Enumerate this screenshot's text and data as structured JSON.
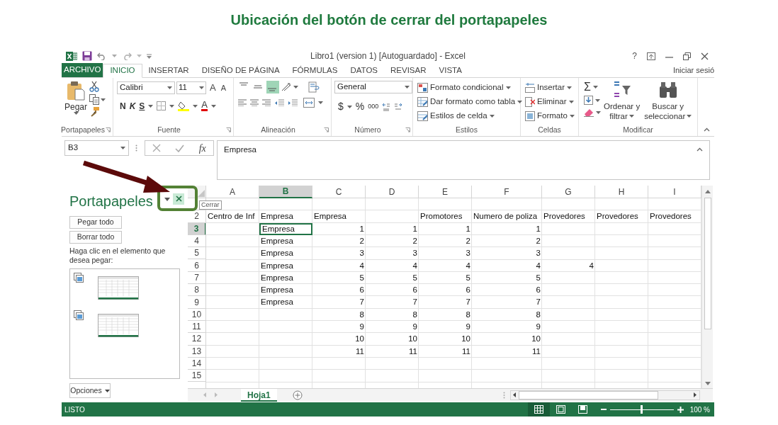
{
  "annotation_title": "Ubicación del botón de cerrar del portapapeles",
  "window": {
    "title": "Libro1 (version 1) [Autoguardado] - Excel",
    "help": "?"
  },
  "tabs": [
    {
      "label": "ARCHIVO",
      "kind": "file",
      "selected": false
    },
    {
      "label": "INICIO",
      "kind": "tab",
      "selected": true
    },
    {
      "label": "INSERTAR",
      "kind": "tab",
      "selected": false
    },
    {
      "label": "DISEÑO DE PÁGINA",
      "kind": "tab",
      "selected": false
    },
    {
      "label": "FÓRMULAS",
      "kind": "tab",
      "selected": false
    },
    {
      "label": "DATOS",
      "kind": "tab",
      "selected": false
    },
    {
      "label": "REVISAR",
      "kind": "tab",
      "selected": false
    },
    {
      "label": "VISTA",
      "kind": "tab",
      "selected": false
    }
  ],
  "account": "Iniciar sesió",
  "ribbon": {
    "groups": [
      {
        "kind": "clipboard",
        "label": "Portapapeles",
        "launcher": true,
        "paste": "Pegar"
      },
      {
        "kind": "font",
        "label": "Fuente",
        "launcher": true,
        "font": "Calibri",
        "size": "11",
        "grow": "A",
        "shrink": "A",
        "bold": "N",
        "italic": "K",
        "underline": "S",
        "font_color": "A"
      },
      {
        "kind": "alignment",
        "label": "Alineación",
        "launcher": true,
        "vertical_align": [
          {
            "selected": false
          },
          {
            "selected": false
          },
          {
            "selected": true
          }
        ]
      },
      {
        "kind": "number",
        "label": "Número",
        "launcher": true,
        "format": "General",
        "currency": "$",
        "percent": "%",
        "thousands": "000"
      },
      {
        "kind": "styles",
        "label": "Estilos",
        "items": [
          "Formato condicional",
          "Dar formato como tabla",
          "Estilos de celda"
        ]
      },
      {
        "kind": "cells",
        "label": "Celdas",
        "items": [
          "Insertar",
          "Eliminar",
          "Formato"
        ]
      },
      {
        "kind": "editing",
        "label": "Modificar",
        "autosum": "Σ",
        "sort": [
          "Ordenar y",
          "filtrar"
        ],
        "find": [
          "Buscar y",
          "seleccionar"
        ]
      }
    ]
  },
  "formula_bar": {
    "name_box": "B3",
    "fx": "fx",
    "formula": "Empresa"
  },
  "clipboard_pane": {
    "title": "Portapapeles",
    "tooltip": "Cerrar",
    "buttons": [
      "Pegar todo",
      "Borrar todo"
    ],
    "hint": "Haga clic en el elemento que desea pegar:",
    "items": [
      {
        "kind": "picture"
      },
      {
        "kind": "picture"
      }
    ],
    "options": "Opciones"
  },
  "sheet": {
    "columns": [
      {
        "label": "A",
        "selected": false
      },
      {
        "label": "B",
        "selected": true
      },
      {
        "label": "C",
        "selected": false
      },
      {
        "label": "D",
        "selected": false
      },
      {
        "label": "E",
        "selected": false
      },
      {
        "label": "F",
        "selected": false
      },
      {
        "label": "G",
        "selected": false
      },
      {
        "label": "H",
        "selected": false
      },
      {
        "label": "I",
        "selected": false
      }
    ],
    "rows": [
      {
        "selected": false,
        "cells": [
          null,
          null,
          null,
          null,
          null,
          null,
          null,
          null,
          null
        ]
      },
      {
        "header": "2",
        "selected": false,
        "cells": [
          {
            "text": "Centro de Inf",
            "kind": "text"
          },
          {
            "text": "Empresa",
            "kind": "text"
          },
          {
            "text": "Empresa",
            "kind": "text"
          },
          null,
          {
            "text": "Promotores",
            "kind": "text"
          },
          {
            "text": "Numero de poliza",
            "kind": "text"
          },
          {
            "text": "Provedores",
            "kind": "text"
          },
          {
            "text": "Provedores",
            "kind": "text"
          },
          {
            "text": "Provedores",
            "kind": "text"
          }
        ]
      },
      {
        "header": "3",
        "selected": true,
        "cells": [
          null,
          {
            "text": "Empresa",
            "kind": "text"
          },
          {
            "text": "1",
            "kind": "number"
          },
          {
            "text": "1",
            "kind": "number"
          },
          {
            "text": "1",
            "kind": "number"
          },
          {
            "text": "1",
            "kind": "number"
          },
          null,
          null,
          null
        ]
      },
      {
        "header": "4",
        "selected": false,
        "cells": [
          null,
          {
            "text": "Empresa",
            "kind": "text"
          },
          {
            "text": "2",
            "kind": "number"
          },
          {
            "text": "2",
            "kind": "number"
          },
          {
            "text": "2",
            "kind": "number"
          },
          {
            "text": "2",
            "kind": "number"
          },
          null,
          null,
          null
        ]
      },
      {
        "header": "5",
        "selected": false,
        "cells": [
          null,
          {
            "text": "Empresa",
            "kind": "text"
          },
          {
            "text": "3",
            "kind": "number"
          },
          {
            "text": "3",
            "kind": "number"
          },
          {
            "text": "3",
            "kind": "number"
          },
          {
            "text": "3",
            "kind": "number"
          },
          null,
          null,
          null
        ]
      },
      {
        "header": "6",
        "selected": false,
        "cells": [
          null,
          {
            "text": "Empresa",
            "kind": "text"
          },
          {
            "text": "4",
            "kind": "number"
          },
          {
            "text": "4",
            "kind": "number"
          },
          {
            "text": "4",
            "kind": "number"
          },
          {
            "text": "4",
            "kind": "number"
          },
          {
            "text": "4",
            "kind": "number"
          },
          null,
          null
        ]
      },
      {
        "header": "7",
        "selected": false,
        "cells": [
          null,
          {
            "text": "Empresa",
            "kind": "text"
          },
          {
            "text": "5",
            "kind": "number"
          },
          {
            "text": "5",
            "kind": "number"
          },
          {
            "text": "5",
            "kind": "number"
          },
          {
            "text": "5",
            "kind": "number"
          },
          null,
          null,
          null
        ]
      },
      {
        "header": "8",
        "selected": false,
        "cells": [
          null,
          {
            "text": "Empresa",
            "kind": "text"
          },
          {
            "text": "6",
            "kind": "number"
          },
          {
            "text": "6",
            "kind": "number"
          },
          {
            "text": "6",
            "kind": "number"
          },
          {
            "text": "6",
            "kind": "number"
          },
          null,
          null,
          null
        ]
      },
      {
        "header": "9",
        "selected": false,
        "cells": [
          null,
          {
            "text": "Empresa",
            "kind": "text"
          },
          {
            "text": "7",
            "kind": "number"
          },
          {
            "text": "7",
            "kind": "number"
          },
          {
            "text": "7",
            "kind": "number"
          },
          {
            "text": "7",
            "kind": "number"
          },
          null,
          null,
          null
        ]
      },
      {
        "header": "10",
        "selected": false,
        "cells": [
          null,
          null,
          {
            "text": "8",
            "kind": "number"
          },
          {
            "text": "8",
            "kind": "number"
          },
          {
            "text": "8",
            "kind": "number"
          },
          {
            "text": "8",
            "kind": "number"
          },
          null,
          null,
          null
        ]
      },
      {
        "header": "11",
        "selected": false,
        "cells": [
          null,
          null,
          {
            "text": "9",
            "kind": "number"
          },
          {
            "text": "9",
            "kind": "number"
          },
          {
            "text": "9",
            "kind": "number"
          },
          {
            "text": "9",
            "kind": "number"
          },
          null,
          null,
          null
        ]
      },
      {
        "header": "12",
        "selected": false,
        "cells": [
          null,
          null,
          {
            "text": "10",
            "kind": "number"
          },
          {
            "text": "10",
            "kind": "number"
          },
          {
            "text": "10",
            "kind": "number"
          },
          {
            "text": "10",
            "kind": "number"
          },
          null,
          null,
          null
        ]
      },
      {
        "header": "13",
        "selected": false,
        "cells": [
          null,
          null,
          {
            "text": "11",
            "kind": "number"
          },
          {
            "text": "11",
            "kind": "number"
          },
          {
            "text": "11",
            "kind": "number"
          },
          {
            "text": "11",
            "kind": "number"
          },
          null,
          null,
          null
        ]
      },
      {
        "header": "14",
        "selected": false,
        "cells": [
          null,
          null,
          null,
          null,
          null,
          null,
          null,
          null,
          null
        ]
      },
      {
        "header": "15",
        "selected": false,
        "cells": [
          null,
          null,
          null,
          null,
          null,
          null,
          null,
          null,
          null
        ]
      }
    ]
  },
  "sheet_tabs": [
    {
      "label": "Hoja1",
      "selected": true
    }
  ],
  "status_bar": {
    "status": "LISTO",
    "views": [
      {
        "kind": "normal",
        "selected": true
      },
      {
        "kind": "page_layout",
        "selected": false
      },
      {
        "kind": "page_break",
        "selected": false
      }
    ],
    "zoom": {
      "level": 0.48,
      "reading": "100 %"
    }
  }
}
